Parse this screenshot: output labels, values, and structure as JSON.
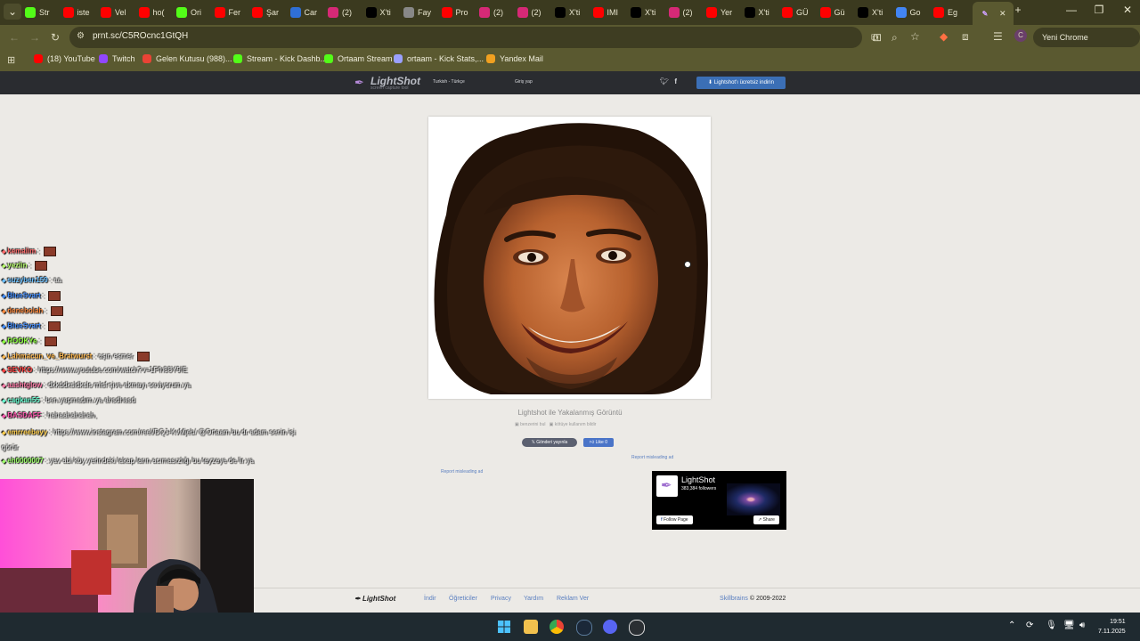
{
  "browser": {
    "tabs": [
      {
        "label": "Str",
        "icon": "kick-icon",
        "color": "#53fc18"
      },
      {
        "label": "iste",
        "icon": "youtube-icon",
        "color": "#ff0000"
      },
      {
        "label": "Vel",
        "icon": "youtube-icon",
        "color": "#ff0000"
      },
      {
        "label": "ho(",
        "icon": "youtube-icon",
        "color": "#ff0000"
      },
      {
        "label": "Ori",
        "icon": "kick-icon",
        "color": "#53fc18"
      },
      {
        "label": "Fer",
        "icon": "youtube-icon",
        "color": "#ff0000"
      },
      {
        "label": "Şar",
        "icon": "youtube-icon",
        "color": "#ff0000"
      },
      {
        "label": "Car",
        "icon": "m-icon",
        "color": "#2f6fd6"
      },
      {
        "label": "(2)",
        "icon": "instagram-icon",
        "color": "#d62976"
      },
      {
        "label": "X'ti",
        "icon": "x-icon",
        "color": "#000000"
      },
      {
        "label": "Fay",
        "icon": "globe-icon",
        "color": "#888888"
      },
      {
        "label": "Pro",
        "icon": "youtube-icon",
        "color": "#ff0000"
      },
      {
        "label": "(2)",
        "icon": "instagram-icon",
        "color": "#d62976"
      },
      {
        "label": "(2)",
        "icon": "instagram-icon",
        "color": "#d62976"
      },
      {
        "label": "X'ti",
        "icon": "x-icon",
        "color": "#000000"
      },
      {
        "label": "IMI",
        "icon": "youtube-icon",
        "color": "#ff0000"
      },
      {
        "label": "X'ti",
        "icon": "x-icon",
        "color": "#000000"
      },
      {
        "label": "(2)",
        "icon": "instagram-icon",
        "color": "#d62976"
      },
      {
        "label": "Yer",
        "icon": "youtube-icon",
        "color": "#ff0000"
      },
      {
        "label": "X'ti",
        "icon": "x-icon",
        "color": "#000000"
      },
      {
        "label": "GÜ",
        "icon": "youtube-icon",
        "color": "#ff0000"
      },
      {
        "label": "Gü",
        "icon": "youtube-icon",
        "color": "#ff0000"
      },
      {
        "label": "X'ti",
        "icon": "x-icon",
        "color": "#000000"
      },
      {
        "label": "Go",
        "icon": "google-icon",
        "color": "#4285f4"
      },
      {
        "label": "Eg",
        "icon": "youtube-icon",
        "color": "#ff0000"
      }
    ],
    "active_tab_icon": "lightshot-feather-icon",
    "url": "prnt.sc/C5ROcnc1GtQH",
    "update_label": "Yeni Chrome kullanılabilir",
    "profile_initial": "C",
    "bookmarks": [
      {
        "label": "(18) YouTube",
        "icon": "youtube-icon",
        "color": "#ff0000"
      },
      {
        "label": "Twitch",
        "icon": "twitch-icon",
        "color": "#9146ff"
      },
      {
        "label": "Gelen Kutusu (988)...",
        "icon": "gmail-icon",
        "color": "#ea4335"
      },
      {
        "label": "Stream - Kick Dashb...",
        "icon": "kick-icon",
        "color": "#53fc18"
      },
      {
        "label": "Ortaam Stream",
        "icon": "kick-icon",
        "color": "#53fc18"
      },
      {
        "label": "ortaam - Kick Stats,...",
        "icon": "stats-icon",
        "color": "#9aa0ff"
      },
      {
        "label": "Yandex Mail",
        "icon": "mail-icon",
        "color": "#f0a020"
      }
    ]
  },
  "site": {
    "logo": "LightShot",
    "logo_sub": "screen capture tool",
    "language": "Turkish - Türkçe",
    "login": "Giriş yap",
    "download_button": "Lightshot'ı ücretsiz indirin",
    "caption": "Lightshot ile Yakalanmış Görüntü",
    "find_similar": "benzerini bul",
    "report_abuse": "kötüye kullanım bildir",
    "share_button": "Gönderi yayınla",
    "like_button": "Like 0",
    "report_ad_1": "Report misleading ad",
    "report_ad_2": "Report misleading ad",
    "fb": {
      "name": "LightShot",
      "followers": "383,384 followers",
      "follow": "Follow Page",
      "share": "Share"
    },
    "footer": {
      "logo": "LightShot",
      "links": [
        "İndir",
        "Öğreticiler",
        "Privacy",
        "Yardım",
        "Reklam Ver"
      ],
      "company": "Skillbrains",
      "copyright": "© 2009-2022"
    }
  },
  "chat": [
    {
      "user": "kemalim",
      "color": "#ff6a6a",
      "text": ":"
    },
    {
      "user": "yezlin",
      "color": "#b6ff6a",
      "text": ":"
    },
    {
      "user": "suzyben159",
      "color": "#6ac0ff",
      "text": ": aa"
    },
    {
      "user": "BlueSvart",
      "color": "#3f8cff",
      "text": ":"
    },
    {
      "user": "denebolah",
      "color": "#ff8a3d",
      "text": ":"
    },
    {
      "user": "BlueSvart",
      "color": "#3f8cff",
      "text": ":"
    },
    {
      "user": "ROOKYe",
      "color": "#8cff3f",
      "text": ":"
    },
    {
      "user": "Lahmacun_ve_Bratwurst",
      "color": "#ffb84d",
      "text": ": aşın esmer"
    },
    {
      "user": "SEVKO",
      "color": "#ff3f3f",
      "text": ": https://www.youtube.com/watch?v=1Ffh88Y9IE"
    },
    {
      "user": "aashtglow",
      "color": "#ff7aa8",
      "text": ": dkkddksldksls mlsf şive akmayı seviyorum ya"
    },
    {
      "user": "cagkan55",
      "color": "#6affd2",
      "text": ": ben yapmadım ya ahsdhasd"
    },
    {
      "user": "BASDAFF",
      "color": "#ff5ab0",
      "text": ": hahaahahahah,"
    },
    {
      "user": "emrreebeyy",
      "color": "#ffcf4d",
      "text": ": https://www.instagram.com/reel/DQJ-KvMjeb/ @Ortaam bu dr adam senin işi görür"
    },
    {
      "user": "eh0000007",
      "color": "#9dff6a",
      "text": ": yav abi köy yerindeki lakap ların acımasızlığı bu teyzeye de lir ya"
    }
  ],
  "taskbar": {
    "time": "19:51",
    "date": "7.11.2025"
  }
}
